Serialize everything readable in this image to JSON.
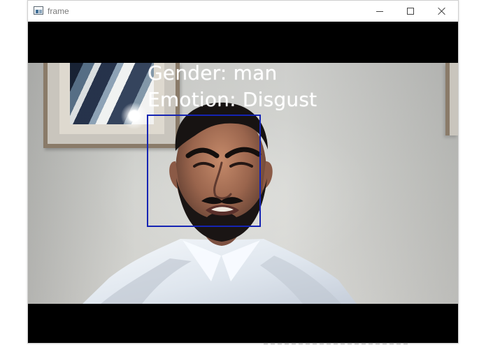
{
  "window": {
    "title": "frame",
    "app_icon": "application-window-icon",
    "controls": [
      {
        "name": "minimize",
        "icon": "minimize-icon"
      },
      {
        "name": "maximize",
        "icon": "maximize-icon"
      },
      {
        "name": "close",
        "icon": "close-icon"
      }
    ]
  },
  "detection": {
    "gender_label": "Gender: man",
    "emotion_label": "Emotion: Disgust",
    "box_color": "#1524b3",
    "text_color": "#ffffff"
  }
}
